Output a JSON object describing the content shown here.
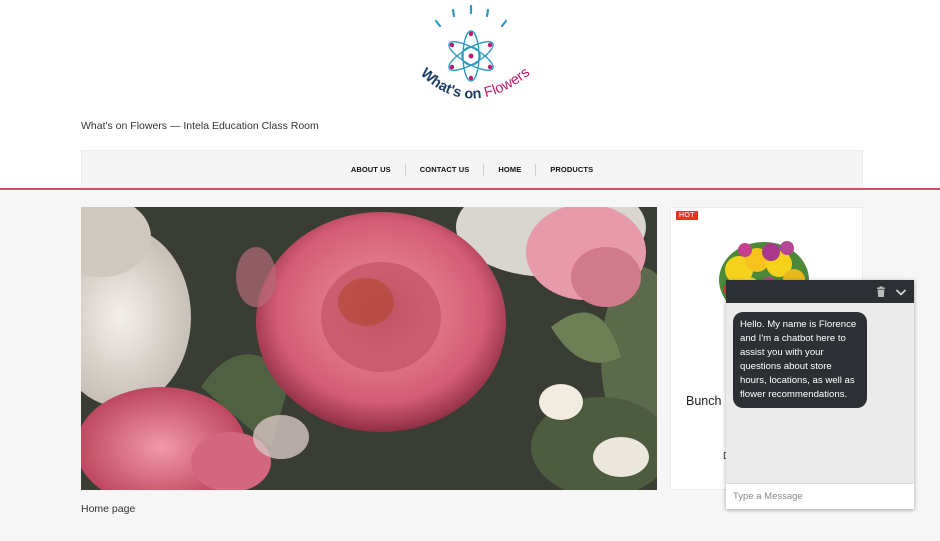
{
  "logo": {
    "text_part1": "What's on",
    "text_part2": "Flowers"
  },
  "site": {
    "tagline": "What's on Flowers — Intela Education Class Room"
  },
  "nav": {
    "items": [
      {
        "label": "ABOUT US"
      },
      {
        "label": "CONTACT US"
      },
      {
        "label": "HOME"
      },
      {
        "label": "PRODUCTS"
      }
    ]
  },
  "main": {
    "page_label": "Home page"
  },
  "product": {
    "badge": "HOT",
    "title": "Bunch",
    "subtitle": "D"
  },
  "chat": {
    "message": "Hello. My name is Florence and I'm a chatbot here to assist you with your questions about store hours, locations, as well as flower recommendations.",
    "input_placeholder": "Type a Message",
    "header_icons": [
      "trash-icon",
      "chevron-down-icon"
    ]
  },
  "colors": {
    "accent_line": "#d84a6c",
    "hot_badge": "#e8361d",
    "chat_dark": "#2c2f33",
    "logo_teal": "#2a9bbf",
    "logo_magenta": "#c1166f",
    "logo_navy": "#1f3f66"
  }
}
